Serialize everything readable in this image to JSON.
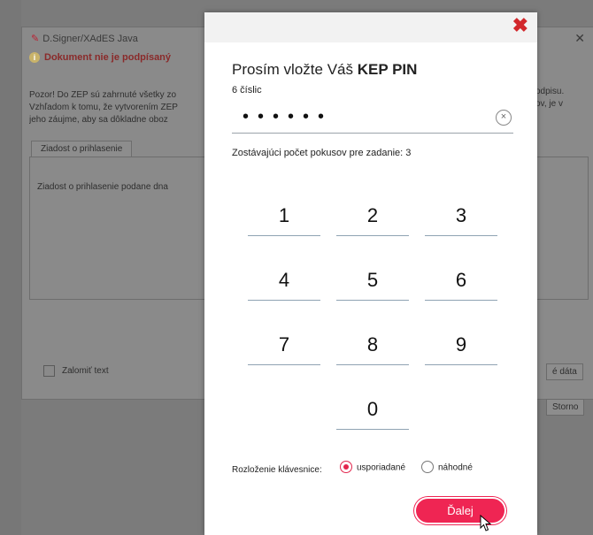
{
  "background": {
    "window_title": "D.Signer/XAdES Java",
    "status": "Dokument nie je podpísaný",
    "warning_lines": [
      "Pozor! Do ZEP sú zahrnuté všetky zo",
      "Vzhľadom k tomu, že vytvorením ZEP",
      "jeho záujme, aby sa dôkladne oboz"
    ],
    "warning_right_lines": [
      "odpisu.",
      "ov, je v"
    ],
    "tab_label": "Ziadost o prihlasenie",
    "panel_text": "Ziadost o prihlasenie podane dna",
    "wrap_label": "Zalomiť text",
    "data_button": "é dáta",
    "cancel_button": "Storno"
  },
  "dialog": {
    "close_glyph": "✖",
    "title_prefix": "Prosím vložte Váš ",
    "title_bold": "KEP PIN",
    "subtitle": "6 číslic",
    "pin_mask": "••••••",
    "clear_glyph": "×",
    "attempts_text": "Zostávajúci počet pokusov pre zadanie: 3",
    "keys": [
      "1",
      "2",
      "3",
      "4",
      "5",
      "6",
      "7",
      "8",
      "9",
      "0"
    ],
    "layout_label": "Rozloženie klávesnice:",
    "layout_ordered": "usporiadané",
    "layout_random": "náhodné",
    "next_button": "Ďalej"
  },
  "colors": {
    "accent": "#ef2553",
    "close": "#d2272b"
  }
}
